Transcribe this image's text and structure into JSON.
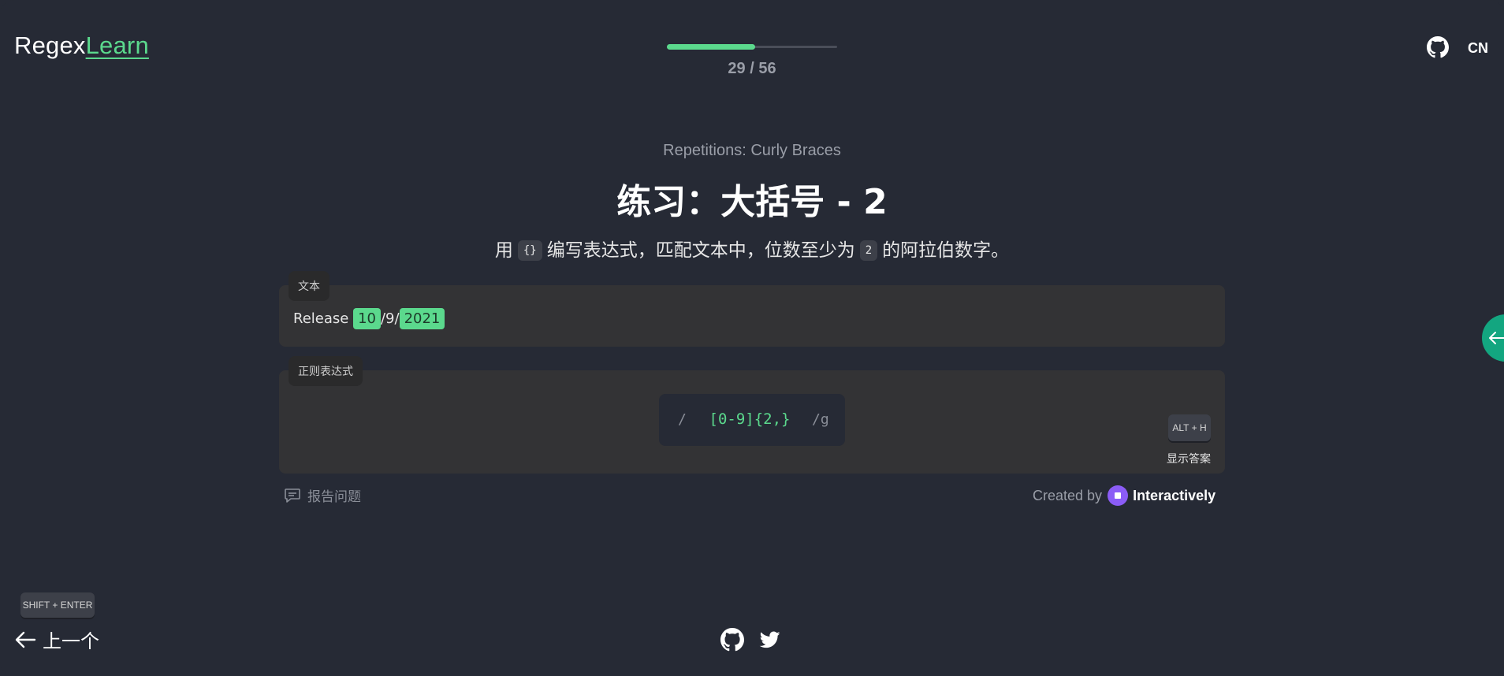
{
  "header": {
    "logo_part1": "Regex",
    "logo_part2": "Learn",
    "progress": {
      "current": 29,
      "total": 56,
      "text": "29 / 56"
    },
    "language": "CN"
  },
  "lesson": {
    "section": "Repetitions: Curly Braces",
    "title": "练习：大括号 - 2",
    "desc_prefix": "用",
    "desc_code1": "{}",
    "desc_middle": "编写表达式，匹配文本中，位数至少为",
    "desc_code2": "2",
    "desc_suffix": "的阿拉伯数字。"
  },
  "text_card": {
    "label": "文本",
    "parts": [
      {
        "text": "Release ",
        "match": false
      },
      {
        "text": "10",
        "match": true
      },
      {
        "text": "/9/",
        "match": false
      },
      {
        "text": "2021",
        "match": true
      }
    ]
  },
  "regex_card": {
    "label": "正则表达式",
    "open_slash": "/",
    "value": "[0-9]{2,}",
    "flags": "/g",
    "hint_shortcut": "ALT + H",
    "show_answer": "显示答案"
  },
  "footer_row": {
    "report": "报告问题",
    "created_by": "Created by",
    "brand": "Interactively"
  },
  "navigation": {
    "prev_shortcut": "SHIFT + ENTER",
    "prev_label": "上一个"
  },
  "icons": {
    "github": "github-icon",
    "twitter": "twitter-icon",
    "arrow_left": "arrow-left-icon",
    "comment": "comment-icon"
  },
  "colors": {
    "background": "#262a35",
    "accent": "#5bd98d",
    "card": "#333335",
    "side_tab": "#13a680",
    "brand": "#8b5cf6"
  }
}
